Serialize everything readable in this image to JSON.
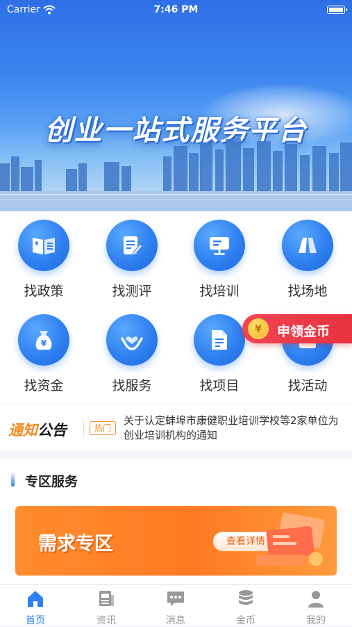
{
  "status_bar": {
    "carrier": "Carrier",
    "time": "7:46 PM"
  },
  "banner": {
    "title": "创业一站式服务平台"
  },
  "services": [
    {
      "label": "找政策",
      "icon": "policy-book-icon"
    },
    {
      "label": "找测评",
      "icon": "assessment-edit-icon"
    },
    {
      "label": "找培训",
      "icon": "training-board-icon"
    },
    {
      "label": "找场地",
      "icon": "venue-road-icon"
    },
    {
      "label": "找资金",
      "icon": "money-bag-icon"
    },
    {
      "label": "找服务",
      "icon": "heart-hands-icon"
    },
    {
      "label": "找项目",
      "icon": "project-document-icon"
    },
    {
      "label": "找活动",
      "icon": "activity-icon"
    }
  ],
  "coin_button": {
    "symbol": "¥",
    "label": "申领金币"
  },
  "notice": {
    "logo_part1": "通知",
    "logo_part2": "公告",
    "tag": "热门",
    "text": "关于认定蚌埠市康健职业培训学校等2家单位为创业培训机构的通知"
  },
  "zone": {
    "heading": "专区服务",
    "card_title": "需求专区",
    "card_button": "查看详情"
  },
  "tabbar": [
    {
      "label": "首页",
      "icon": "home-icon",
      "active": true
    },
    {
      "label": "资讯",
      "icon": "news-icon",
      "active": false
    },
    {
      "label": "消息",
      "icon": "message-icon",
      "active": false
    },
    {
      "label": "金币",
      "icon": "coins-icon",
      "active": false
    },
    {
      "label": "我的",
      "icon": "profile-icon",
      "active": false
    }
  ],
  "colors": {
    "primary": "#2f80f0",
    "accent_orange": "#ff7a22",
    "coin_red": "#e8313f"
  }
}
